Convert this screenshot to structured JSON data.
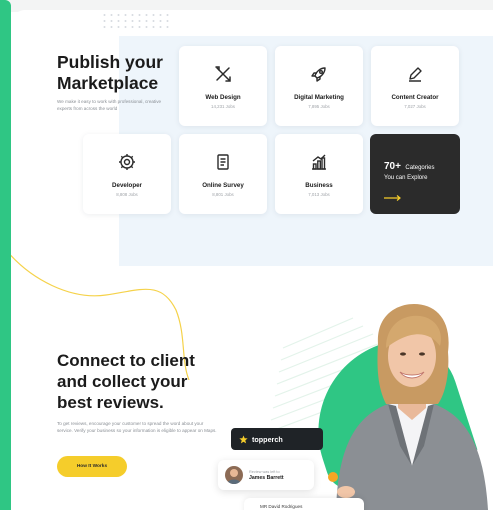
{
  "hero": {
    "heading_line1": "Publish your",
    "heading_line2": "Marketplace",
    "subtext": "We make it easy to work with professional, creative experts from across the world"
  },
  "categories": [
    {
      "title": "Web Design",
      "sub": "14,231 Jobs",
      "icon": "tools-icon"
    },
    {
      "title": "Digital Marketing",
      "sub": "7,895 Jobs",
      "icon": "rocket-icon"
    },
    {
      "title": "Content Creator",
      "sub": "7,027 Jobs",
      "icon": "pen-icon"
    },
    {
      "title": "Developer",
      "sub": "8,808 Jobs",
      "icon": "gear-icon"
    },
    {
      "title": "Online Survey",
      "sub": "8,801 Jobs",
      "icon": "document-icon"
    },
    {
      "title": "Business",
      "sub": "7,013 Jobs",
      "icon": "bar-chart-icon"
    }
  ],
  "more_card": {
    "count": "70+",
    "label_line1": "Categories",
    "label_line2": "You can Explore"
  },
  "section2": {
    "heading_line1": "Connect to client",
    "heading_line2": "and collect your",
    "heading_line3": "best reviews.",
    "subtext": "To get reviews, encourage your customer to spread the word about your service. Verify your business so your information is eligible to appear on Maps.",
    "button_label": "How It Works"
  },
  "brand": {
    "name": "topperch"
  },
  "review_card": {
    "caption": "Review was left to",
    "name": "James Barrett"
  },
  "review_card2": {
    "name": "MR David Rodrigues"
  },
  "colors": {
    "accent_green": "#2fc684",
    "accent_yellow": "#f5cd2b",
    "dark": "#2b2b2b"
  }
}
